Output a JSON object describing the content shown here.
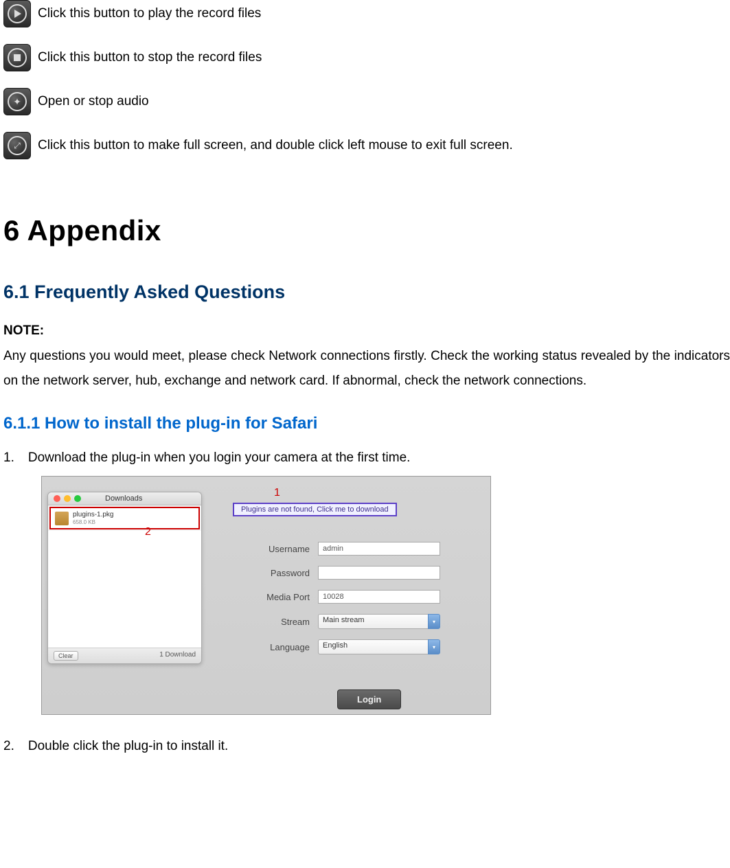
{
  "icon_rows": [
    {
      "text": "Click this button to play the record files"
    },
    {
      "text": "Click this button to stop the record files"
    },
    {
      "text": "Open or stop audio"
    },
    {
      "text": "Click this button to make full screen, and double click left mouse to exit full screen."
    }
  ],
  "heading_main": "6    Appendix",
  "heading_sub": "6.1    Frequently Asked Questions",
  "note_label": "NOTE:",
  "note_text": "Any questions you would meet, please check Network connections firstly. Check the working status revealed by the indicators on the network server, hub, exchange and network card. If abnormal, check the network connections.",
  "heading_sub2": "6.1.1    How to install the plug-in for Safari",
  "steps": [
    {
      "num": "1.",
      "text": "Download the plug-in when you login your camera at the first time."
    },
    {
      "num": "2.",
      "text": "Double click the plug-in to install it."
    }
  ],
  "downloads": {
    "title": "Downloads",
    "item_name": "plugins-1.pkg",
    "item_size": "658.0 KB",
    "clear": "Clear",
    "footer": "1 Download"
  },
  "markers": {
    "one": "1",
    "two": "2"
  },
  "plugins_msg": "Plugins are not found, Click me to download",
  "form": {
    "username_label": "Username",
    "username_value": "admin",
    "password_label": "Password",
    "password_value": "",
    "mediaport_label": "Media Port",
    "mediaport_value": "10028",
    "stream_label": "Stream",
    "stream_value": "Main stream",
    "language_label": "Language",
    "language_value": "English",
    "login_btn": "Login"
  }
}
